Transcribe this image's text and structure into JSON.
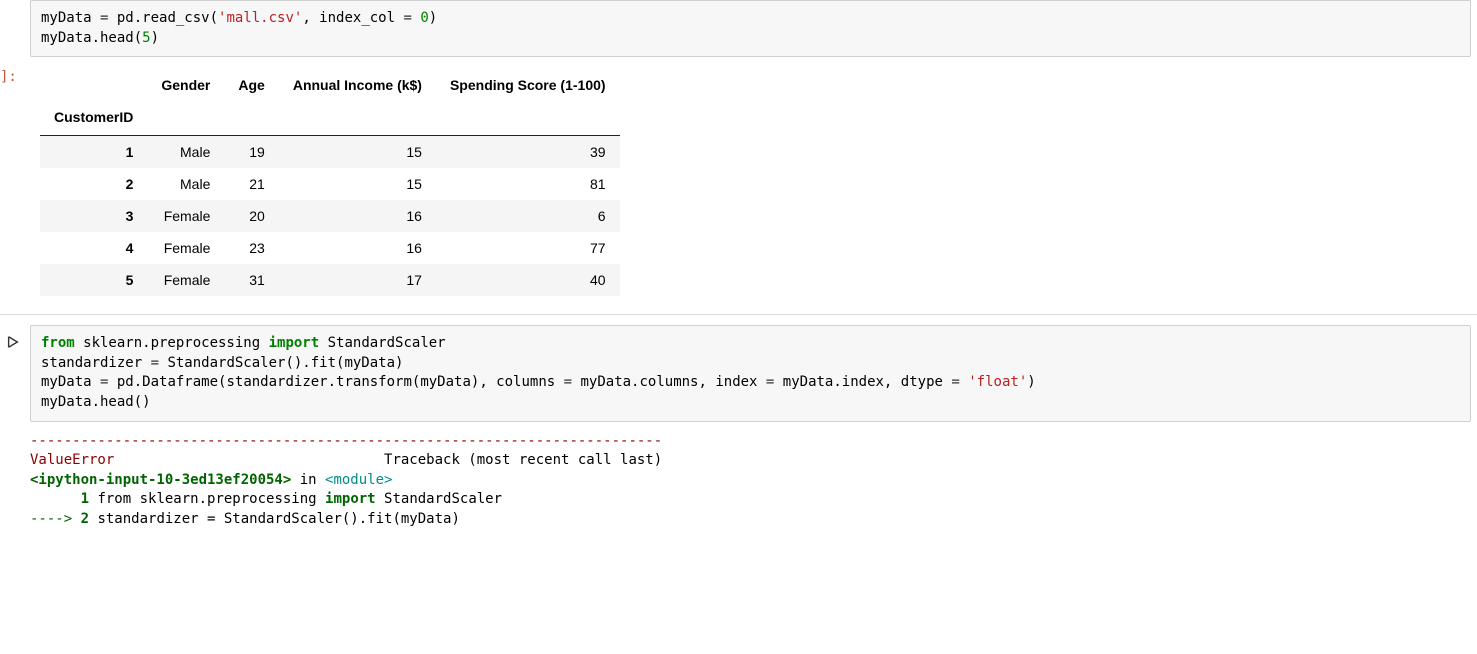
{
  "cell1": {
    "code_tokens": [
      {
        "t": "myData ",
        "c": "c-id"
      },
      {
        "t": "=",
        "c": "c-op"
      },
      {
        "t": " pd.read_csv(",
        "c": "c-id"
      },
      {
        "t": "'mall.csv'",
        "c": "c-str"
      },
      {
        "t": ", index_col ",
        "c": "c-id"
      },
      {
        "t": "=",
        "c": "c-op"
      },
      {
        "t": " ",
        "c": "c-id"
      },
      {
        "t": "0",
        "c": "c-num"
      },
      {
        "t": ")",
        "c": "c-id"
      },
      {
        "t": "\n",
        "c": ""
      },
      {
        "t": "myData.head(",
        "c": "c-id"
      },
      {
        "t": "5",
        "c": "c-num"
      },
      {
        "t": ")",
        "c": "c-id"
      }
    ]
  },
  "out_prompt": "]:",
  "dataframe": {
    "index_name": "CustomerID",
    "columns": [
      "Gender",
      "Age",
      "Annual Income (k$)",
      "Spending Score (1-100)"
    ],
    "index": [
      "1",
      "2",
      "3",
      "4",
      "5"
    ],
    "rows": [
      [
        "Male",
        "19",
        "15",
        "39"
      ],
      [
        "Male",
        "21",
        "15",
        "81"
      ],
      [
        "Female",
        "20",
        "16",
        "6"
      ],
      [
        "Female",
        "23",
        "16",
        "77"
      ],
      [
        "Female",
        "31",
        "17",
        "40"
      ]
    ]
  },
  "cell2": {
    "code_tokens": [
      {
        "t": "from",
        "c": "c-kw"
      },
      {
        "t": " sklearn.preprocessing ",
        "c": "c-id"
      },
      {
        "t": "import",
        "c": "c-kw"
      },
      {
        "t": " StandardScaler",
        "c": "c-id"
      },
      {
        "t": "\n",
        "c": ""
      },
      {
        "t": "standardizer ",
        "c": "c-id"
      },
      {
        "t": "=",
        "c": "c-op"
      },
      {
        "t": " StandardScaler().fit(myData)",
        "c": "c-id"
      },
      {
        "t": "\n",
        "c": ""
      },
      {
        "t": "myData ",
        "c": "c-id"
      },
      {
        "t": "=",
        "c": "c-op"
      },
      {
        "t": " pd.Dataframe(standardizer.transform(myData), columns ",
        "c": "c-id"
      },
      {
        "t": "=",
        "c": "c-op"
      },
      {
        "t": " myData.columns, index ",
        "c": "c-id"
      },
      {
        "t": "=",
        "c": "c-op"
      },
      {
        "t": " myData.index, dtype ",
        "c": "c-id"
      },
      {
        "t": "=",
        "c": "c-op"
      },
      {
        "t": " ",
        "c": "c-id"
      },
      {
        "t": "'float'",
        "c": "c-str"
      },
      {
        "t": ")",
        "c": "c-id"
      },
      {
        "t": "\n",
        "c": ""
      },
      {
        "t": "myData.head()",
        "c": "c-id"
      }
    ]
  },
  "traceback": {
    "dashes": "---------------------------------------------------------------------------",
    "err_name": "ValueError",
    "err_spacer": "                                ",
    "err_tail": "Traceback (most recent call last)",
    "loc": "<ipython-input-10-3ed13ef20054>",
    "in_word": " in ",
    "module": "<module>",
    "line1_pre": "      ",
    "line1_num": "1",
    "line1_rest_a": " from sklearn.preprocessing ",
    "line1_kw": "import",
    "line1_rest_b": " StandardScaler",
    "line2_arrow": "----> ",
    "line2_num": "2",
    "line2_rest": " standardizer = StandardScaler().fit(myData)"
  }
}
